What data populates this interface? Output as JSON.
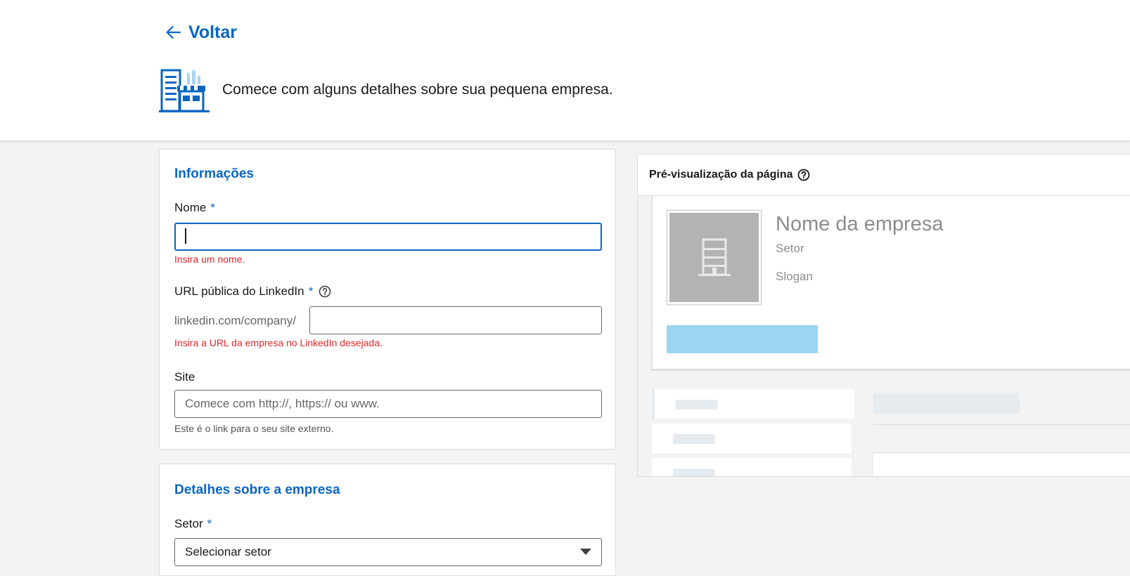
{
  "header": {
    "back_label": "Voltar",
    "tagline": "Comece com alguns detalhes sobre sua pequena empresa."
  },
  "info_section": {
    "title": "Informações",
    "name_field": {
      "label": "Nome",
      "required_mark": "*",
      "value": "",
      "error": "Insira um nome."
    },
    "url_field": {
      "label": "URL pública do LinkedIn",
      "required_mark": "*",
      "prefix": "linkedin.com/company/",
      "value": "",
      "error": "Insira a URL da empresa no LinkedIn desejada."
    },
    "site_field": {
      "label": "Site",
      "placeholder": "Comece com http://, https:// ou www.",
      "hint": "Este é o link para o seu site externo."
    }
  },
  "details_section": {
    "title": "Detalhes sobre a empresa",
    "sector_field": {
      "label": "Setor",
      "required_mark": "*",
      "selected": "Selecionar setor"
    }
  },
  "preview": {
    "title": "Pré-visualização da página",
    "company_name": "Nome da empresa",
    "sector": "Setor",
    "slogan": "Slogan"
  },
  "colors": {
    "accent": "#0a66c2",
    "error": "#e0282b",
    "follow_placeholder": "#9cd5f2",
    "logo_placeholder": "#b3b3b3"
  }
}
